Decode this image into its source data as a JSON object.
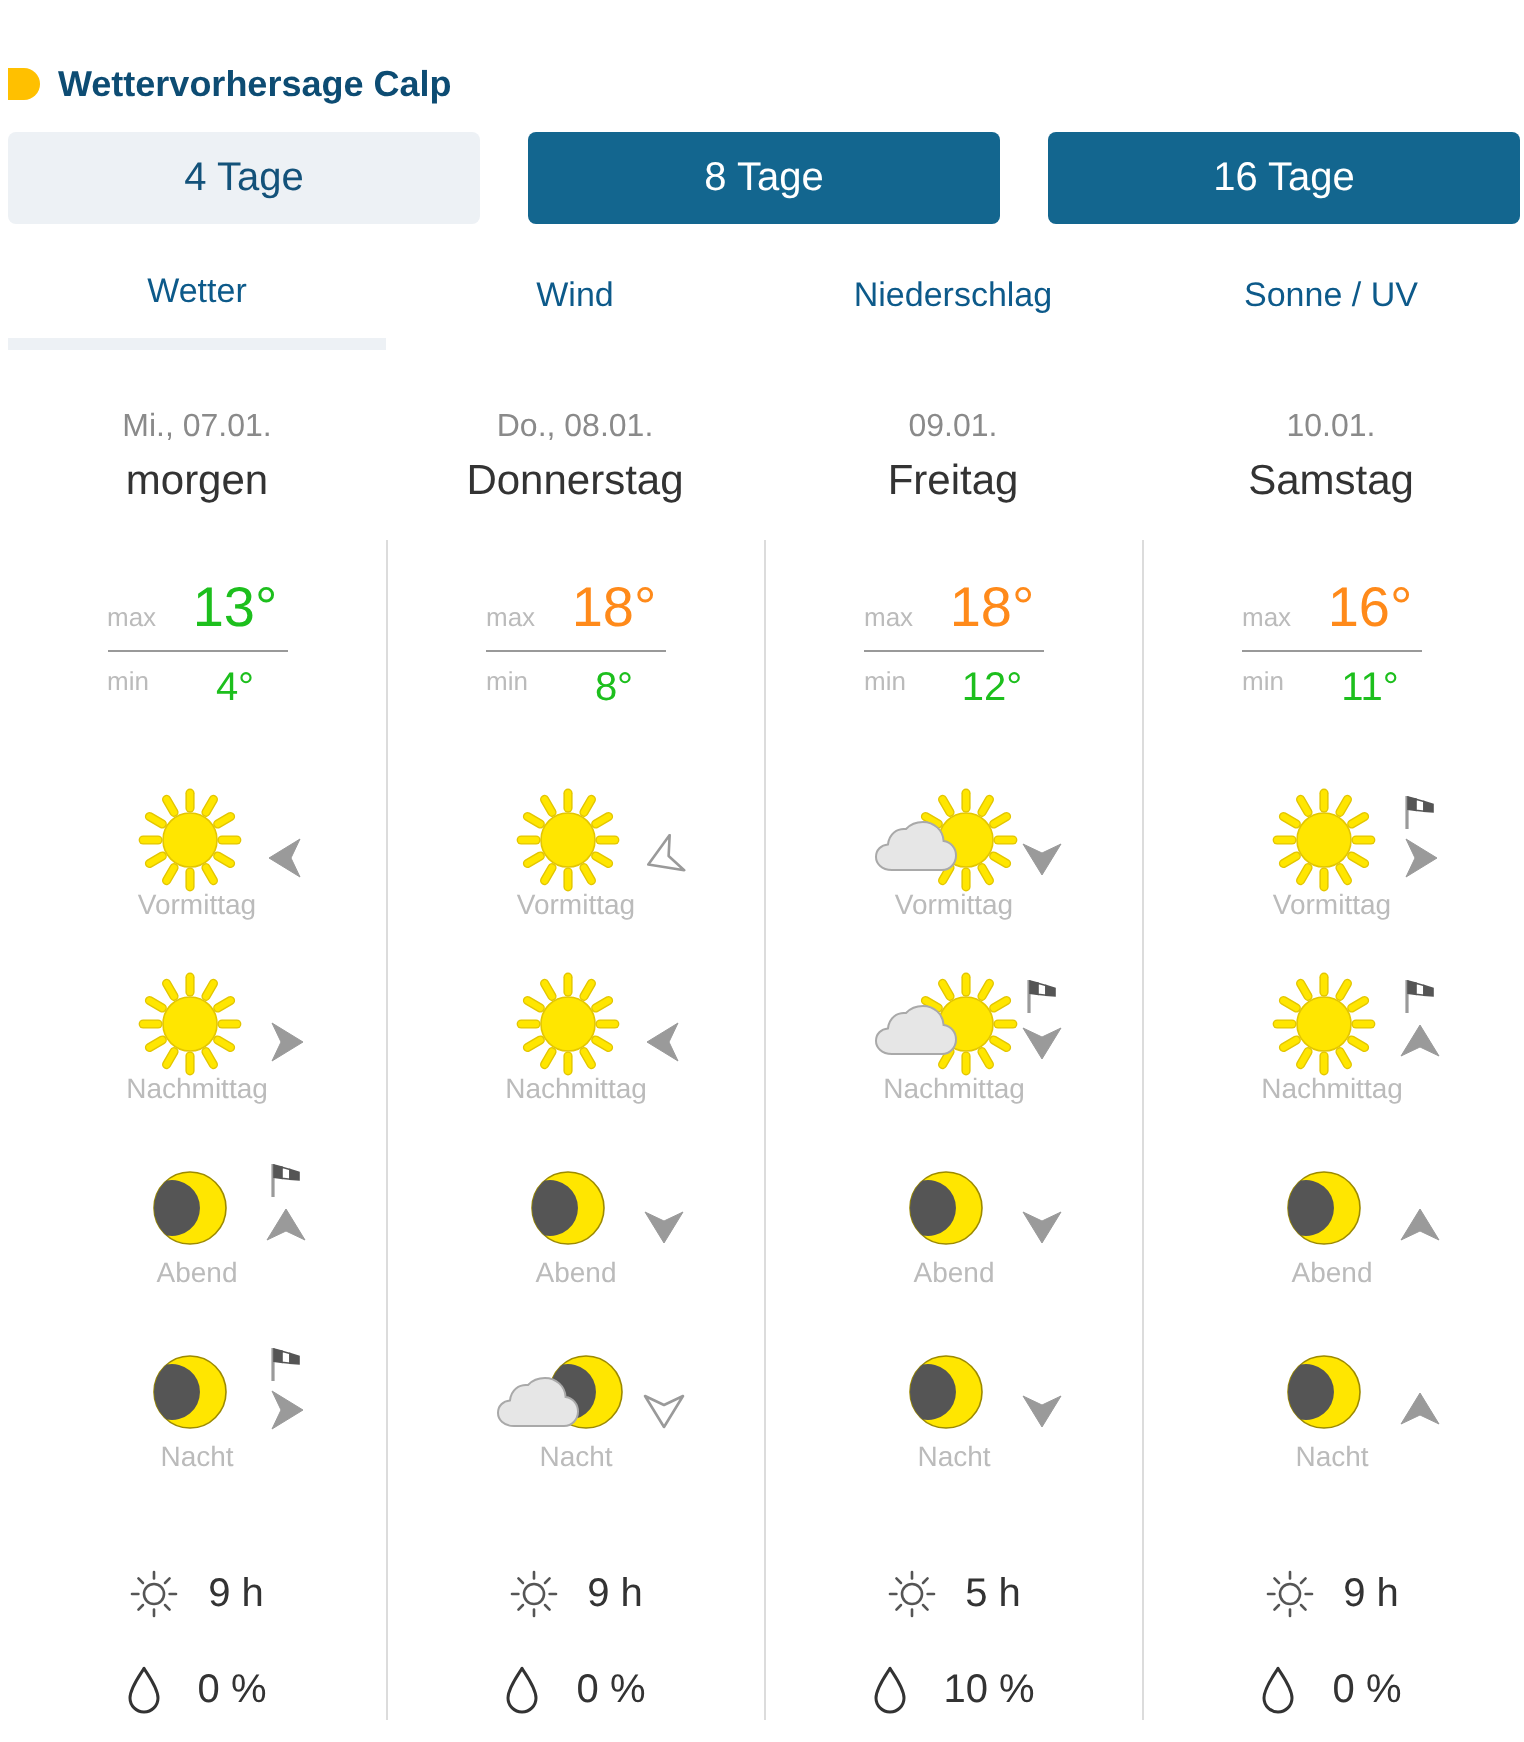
{
  "header": {
    "title": "Wettervorhersage Calp"
  },
  "range_buttons": [
    {
      "label": "4 Tage",
      "selected": true
    },
    {
      "label": "8 Tage",
      "selected": false
    },
    {
      "label": "16 Tage",
      "selected": false
    }
  ],
  "tabs": [
    {
      "label": "Wetter",
      "selected": true
    },
    {
      "label": "Wind",
      "selected": false
    },
    {
      "label": "Niederschlag",
      "selected": false
    },
    {
      "label": "Sonne / UV",
      "selected": false
    }
  ],
  "days": [
    {
      "date": "Mi., 07.01.",
      "name": "morgen",
      "max": {
        "label": "max",
        "value": "13°",
        "color": "#1dbf1d"
      },
      "min": {
        "label": "min",
        "value": "4°",
        "color": "#1dbf1d"
      },
      "periods": [
        {
          "label": "Vormittag",
          "kind": "sun",
          "wind": {
            "kind": "W",
            "light": false
          },
          "gusts": false
        },
        {
          "label": "Nachmittag",
          "kind": "sun",
          "wind": {
            "kind": "E",
            "light": false
          },
          "gusts": false
        },
        {
          "label": "Abend",
          "kind": "moon",
          "wind": {
            "kind": "N",
            "light": false
          },
          "gusts": true
        },
        {
          "label": "Nacht",
          "kind": "moon",
          "wind": {
            "kind": "E",
            "light": false
          },
          "gusts": true
        }
      ],
      "sunshine": "9 h",
      "precipitation": "0 %"
    },
    {
      "date": "Do., 08.01.",
      "name": "Donnerstag",
      "max": {
        "label": "max",
        "value": "18°",
        "color": "#ff8a1a"
      },
      "min": {
        "label": "min",
        "value": "8°",
        "color": "#1dbf1d"
      },
      "periods": [
        {
          "label": "Vormittag",
          "kind": "sun",
          "wind": {
            "kind": "WSW",
            "light": true
          },
          "gusts": false
        },
        {
          "label": "Nachmittag",
          "kind": "sun",
          "wind": {
            "kind": "W",
            "light": false
          },
          "gusts": false
        },
        {
          "label": "Abend",
          "kind": "moon",
          "wind": {
            "kind": "S",
            "light": false
          },
          "gusts": false
        },
        {
          "label": "Nacht",
          "kind": "moon_cloud",
          "wind": {
            "kind": "S",
            "light": true
          },
          "gusts": false
        }
      ],
      "sunshine": "9 h",
      "precipitation": "0 %"
    },
    {
      "date": "09.01.",
      "name": "Freitag",
      "max": {
        "label": "max",
        "value": "18°",
        "color": "#ff8a1a"
      },
      "min": {
        "label": "min",
        "value": "12°",
        "color": "#1dbf1d"
      },
      "periods": [
        {
          "label": "Vormittag",
          "kind": "sun_cloud",
          "wind": {
            "kind": "S",
            "light": false
          },
          "gusts": false
        },
        {
          "label": "Nachmittag",
          "kind": "sun_cloud",
          "wind": {
            "kind": "S",
            "light": false
          },
          "gusts": true
        },
        {
          "label": "Abend",
          "kind": "moon",
          "wind": {
            "kind": "S",
            "light": false
          },
          "gusts": false
        },
        {
          "label": "Nacht",
          "kind": "moon",
          "wind": {
            "kind": "S",
            "light": false
          },
          "gusts": false
        }
      ],
      "sunshine": "5 h",
      "precipitation": "10 %"
    },
    {
      "date": "10.01.",
      "name": "Samstag",
      "max": {
        "label": "max",
        "value": "16°",
        "color": "#ff8a1a"
      },
      "min": {
        "label": "min",
        "value": "11°",
        "color": "#1dbf1d"
      },
      "periods": [
        {
          "label": "Vormittag",
          "kind": "sun",
          "wind": {
            "kind": "E",
            "light": false
          },
          "gusts": true
        },
        {
          "label": "Nachmittag",
          "kind": "sun",
          "wind": {
            "kind": "N",
            "light": false
          },
          "gusts": true
        },
        {
          "label": "Abend",
          "kind": "moon",
          "wind": {
            "kind": "N",
            "light": false
          },
          "gusts": false
        },
        {
          "label": "Nacht",
          "kind": "moon",
          "wind": {
            "kind": "N",
            "light": false
          },
          "gusts": false
        }
      ],
      "sunshine": "9 h",
      "precipitation": "0 %"
    }
  ]
}
